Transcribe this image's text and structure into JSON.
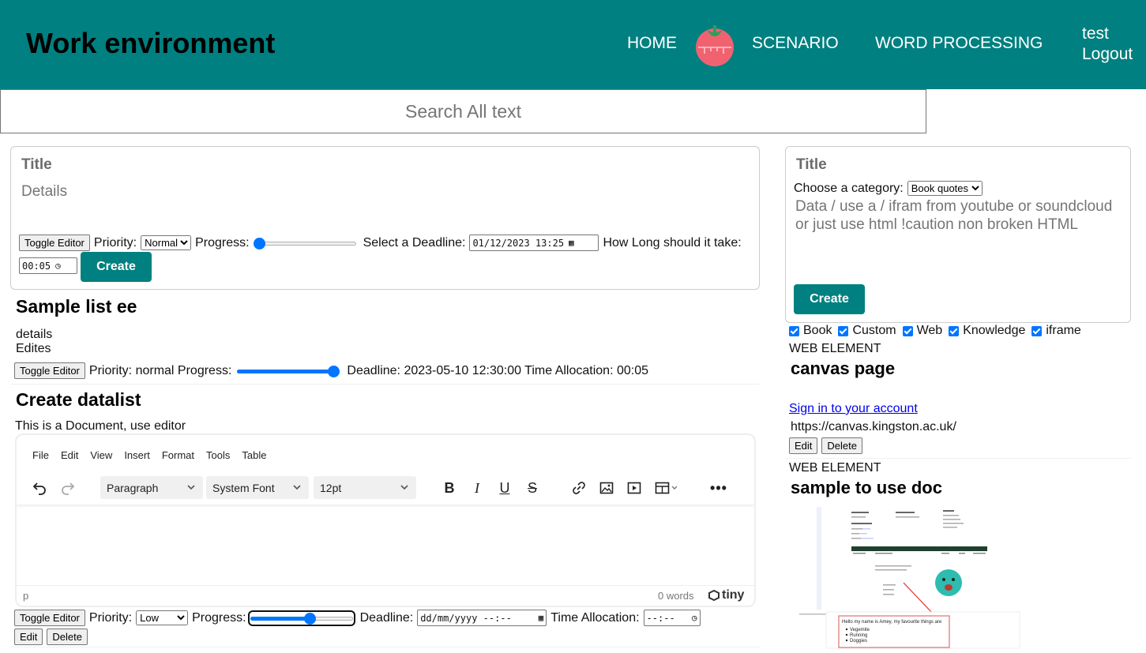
{
  "header": {
    "brand": "Work environment",
    "nav": {
      "home": "HOME",
      "scenario": "SCENARIO",
      "word_processing": "WORD PROCESSING"
    },
    "user": "test",
    "logout": "Logout",
    "colors": {
      "header_bg": "#008080",
      "accent": "#008080"
    }
  },
  "search": {
    "placeholder": "Search All text"
  },
  "new_task": {
    "title_placeholder": "Title",
    "details_placeholder": "Details",
    "toggle_editor": "Toggle Editor",
    "priority_label": "Priority:",
    "priority_value": "Normal",
    "progress_label": "Progress:",
    "progress_value": 0,
    "deadline_label": "Select a Deadline:",
    "deadline_value": "01/12/2023 13:25",
    "duration_label": "How Long should it take:",
    "duration_value": "00:05",
    "create": "Create"
  },
  "tasks": [
    {
      "title": "Sample list ee",
      "details_line1": "details",
      "details_line2": "Edites",
      "toggle_editor": "Toggle Editor",
      "info": "Priority: normal Progress:",
      "progress_value": 100,
      "deadline": "Deadline: 2023-05-10 12:30:00 Time Allocation: 00:05"
    },
    {
      "title": "Create datalist",
      "details": "This is a Document, use editor",
      "toggle_editor": "Toggle Editor",
      "priority_label": "Priority:",
      "priority_value": "Low",
      "progress_label": "Progress:",
      "progress_value": 50,
      "deadline_label": "Deadline:",
      "deadline_value": "dd/mm/yyyy --:--",
      "time_label": "Time Allocation:",
      "time_value": "--:--",
      "edit": "Edit",
      "delete": "Delete"
    }
  ],
  "editor": {
    "menu": [
      "File",
      "Edit",
      "View",
      "Insert",
      "Format",
      "Tools",
      "Table"
    ],
    "block_format": "Paragraph",
    "font_family": "System Font",
    "font_size": "12pt",
    "status_path": "p",
    "word_count": "0 words",
    "brand": "tiny",
    "icons": [
      "undo-icon",
      "redo-icon",
      "bold-icon",
      "italic-icon",
      "underline-icon",
      "strikethrough-icon",
      "link-icon",
      "image-icon",
      "media-icon",
      "table-icon",
      "more-icon"
    ]
  },
  "web_form": {
    "title_placeholder": "Title",
    "category_label": "Choose a category:",
    "category_value": "Book quotes",
    "data_placeholder": "Data / use a / ifram from youtube or soundcloud or just use html !caution non broken HTML",
    "create": "Create"
  },
  "filters": [
    "Book",
    "Custom",
    "Web",
    "Knowledge",
    "iframe"
  ],
  "web_elements": [
    {
      "type": "WEB ELEMENT",
      "title": "canvas page",
      "link": "Sign in to your account",
      "url": "https://canvas.kingston.ac.uk/",
      "edit": "Edit",
      "delete": "Delete"
    },
    {
      "type": "WEB ELEMENT",
      "title": "sample to use doc",
      "preview_intro": "Hello my name is Amey, my favourite things are",
      "preview_items": [
        "Vegemite",
        "Running",
        "Doggies"
      ]
    }
  ]
}
